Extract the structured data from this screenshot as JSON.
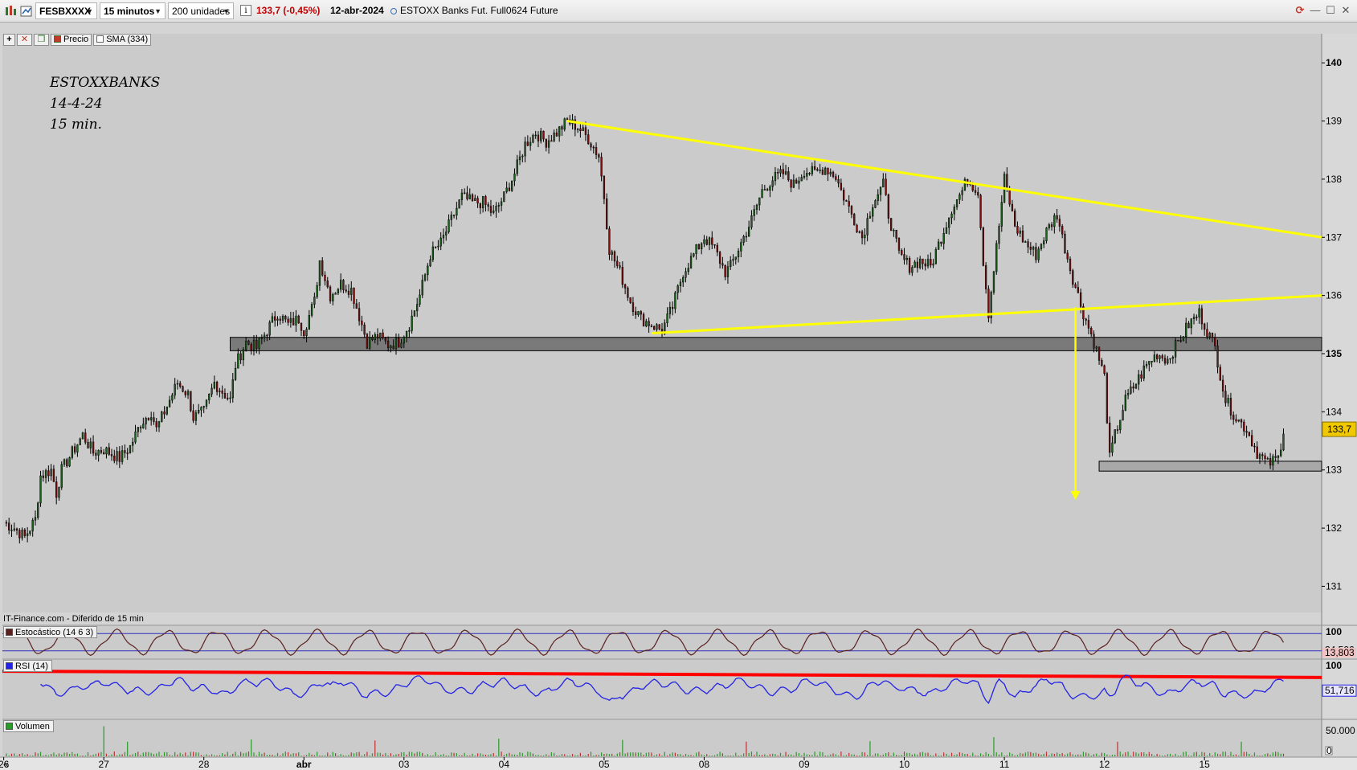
{
  "toolbar": {
    "symbol": "FESBXXXX",
    "interval": "15 minutos",
    "units": "200 unidades",
    "price_change": "133,7 (-0,45%)",
    "date": "12-abr-2024",
    "description": "ESTOXX Banks Fut. Full0624 Future",
    "icons": [
      "chart-icon",
      "compare-icon",
      "info-icon",
      "refresh-icon",
      "minimize-icon",
      "restore-icon",
      "close-icon"
    ],
    "info_glyph": "i",
    "win_glyphs": {
      "refresh": "⟳",
      "minimize": "—",
      "restore": "☐",
      "close": "✕"
    }
  },
  "legend": {
    "price_label": "Precio",
    "sma_label": "SMA (334)"
  },
  "annotation": {
    "line1": "ESTOXXBANKS",
    "line2": "14-4-24",
    "line3": "15 min."
  },
  "source_note": "IT-Finance.com - Diferido de 15 min",
  "panes": {
    "stochastic": {
      "label": "Estocástico (14 6 3)",
      "value1": "24,506",
      "value2": "13,803",
      "top_label": "100"
    },
    "rsi": {
      "label": "RSI (14)",
      "value": "51,716",
      "top_label": "100"
    },
    "volume": {
      "label": "Volumen",
      "top_label": "50.000",
      "bottom_label": "0"
    }
  },
  "colors": {
    "background": "#cbcbcb",
    "candle": "#000000",
    "trendline": "#ffff00",
    "rsi": "#2323e6",
    "rsi_trend": "#ff0000",
    "stochastic": "#5a2020",
    "price_tag": "#f0c800"
  },
  "chart_data": {
    "type": "candlestick",
    "current_price": 133.7,
    "current_price_label": "133,7",
    "ylim": [
      130.55,
      140.5
    ],
    "yticks": [
      131,
      132,
      133,
      134,
      135,
      136,
      137,
      138,
      139,
      140
    ],
    "x_date_labels": [
      {
        "label": "26",
        "idx": 0
      },
      {
        "label": "27",
        "idx": 38
      },
      {
        "label": "28",
        "idx": 76
      },
      {
        "label": "abr",
        "idx": 114
      },
      {
        "label": "03",
        "idx": 152
      },
      {
        "label": "04",
        "idx": 190
      },
      {
        "label": "05",
        "idx": 228
      },
      {
        "label": "08",
        "idx": 266
      },
      {
        "label": "09",
        "idx": 304
      },
      {
        "label": "10",
        "idx": 342
      },
      {
        "label": "11",
        "idx": 380
      },
      {
        "label": "12",
        "idx": 418
      },
      {
        "label": "15",
        "idx": 456
      }
    ],
    "x_total_bars": 501,
    "close_path": [
      [
        0,
        132.1
      ],
      [
        4,
        132.0
      ],
      [
        8,
        131.85
      ],
      [
        12,
        132.15
      ],
      [
        14,
        132.9
      ],
      [
        18,
        133.0
      ],
      [
        20,
        132.6
      ],
      [
        22,
        133.0
      ],
      [
        26,
        133.3
      ],
      [
        30,
        133.6
      ],
      [
        34,
        133.3
      ],
      [
        38,
        133.35
      ],
      [
        44,
        133.2
      ],
      [
        48,
        133.4
      ],
      [
        52,
        133.8
      ],
      [
        56,
        134.0
      ],
      [
        58,
        133.7
      ],
      [
        62,
        134.1
      ],
      [
        66,
        134.5
      ],
      [
        70,
        134.3
      ],
      [
        72,
        133.9
      ],
      [
        76,
        134.0
      ],
      [
        80,
        134.5
      ],
      [
        86,
        134.2
      ],
      [
        88,
        134.8
      ],
      [
        92,
        135.2
      ],
      [
        96,
        135.1
      ],
      [
        100,
        135.4
      ],
      [
        104,
        135.7
      ],
      [
        108,
        135.5
      ],
      [
        112,
        135.6
      ],
      [
        114,
        135.4
      ],
      [
        118,
        135.9
      ],
      [
        120,
        136.6
      ],
      [
        124,
        136.0
      ],
      [
        128,
        136.2
      ],
      [
        132,
        136.1
      ],
      [
        134,
        135.8
      ],
      [
        138,
        135.2
      ],
      [
        142,
        135.3
      ],
      [
        146,
        135.15
      ],
      [
        150,
        135.2
      ],
      [
        154,
        135.5
      ],
      [
        158,
        136.0
      ],
      [
        162,
        136.7
      ],
      [
        166,
        136.9
      ],
      [
        170,
        137.3
      ],
      [
        174,
        137.7
      ],
      [
        178,
        137.6
      ],
      [
        182,
        137.6
      ],
      [
        186,
        137.4
      ],
      [
        190,
        137.7
      ],
      [
        194,
        138.1
      ],
      [
        198,
        138.6
      ],
      [
        202,
        138.8
      ],
      [
        206,
        138.65
      ],
      [
        210,
        138.8
      ],
      [
        214,
        139.0
      ],
      [
        218,
        138.9
      ],
      [
        222,
        138.7
      ],
      [
        226,
        138.4
      ],
      [
        228,
        137.7
      ],
      [
        230,
        136.8
      ],
      [
        234,
        136.4
      ],
      [
        238,
        135.9
      ],
      [
        242,
        135.6
      ],
      [
        246,
        135.5
      ],
      [
        250,
        135.4
      ],
      [
        254,
        135.8
      ],
      [
        258,
        136.4
      ],
      [
        262,
        136.7
      ],
      [
        266,
        137.0
      ],
      [
        270,
        136.8
      ],
      [
        274,
        136.4
      ],
      [
        276,
        136.5
      ],
      [
        280,
        136.9
      ],
      [
        284,
        137.3
      ],
      [
        288,
        137.8
      ],
      [
        292,
        138.0
      ],
      [
        296,
        138.1
      ],
      [
        300,
        137.9
      ],
      [
        304,
        138.15
      ],
      [
        308,
        138.1
      ],
      [
        312,
        138.2
      ],
      [
        316,
        138.05
      ],
      [
        318,
        137.8
      ],
      [
        322,
        137.4
      ],
      [
        326,
        137.0
      ],
      [
        330,
        137.6
      ],
      [
        334,
        137.9
      ],
      [
        336,
        137.4
      ],
      [
        340,
        136.7
      ],
      [
        344,
        136.5
      ],
      [
        348,
        136.6
      ],
      [
        352,
        136.5
      ],
      [
        356,
        137.0
      ],
      [
        360,
        137.5
      ],
      [
        364,
        137.8
      ],
      [
        366,
        138.0
      ],
      [
        370,
        137.8
      ],
      [
        372,
        136.6
      ],
      [
        374,
        135.7
      ],
      [
        378,
        137.2
      ],
      [
        380,
        138.0
      ],
      [
        384,
        137.2
      ],
      [
        388,
        136.9
      ],
      [
        392,
        136.7
      ],
      [
        396,
        137.1
      ],
      [
        400,
        137.4
      ],
      [
        402,
        137.0
      ],
      [
        406,
        136.3
      ],
      [
        410,
        135.7
      ],
      [
        414,
        135.2
      ],
      [
        418,
        134.6
      ],
      [
        420,
        133.2
      ],
      [
        422,
        133.6
      ],
      [
        426,
        134.2
      ],
      [
        430,
        134.5
      ],
      [
        434,
        134.8
      ],
      [
        438,
        135.0
      ],
      [
        442,
        134.9
      ],
      [
        446,
        135.2
      ],
      [
        450,
        135.5
      ],
      [
        454,
        135.7
      ],
      [
        458,
        135.3
      ],
      [
        460,
        135.1
      ],
      [
        464,
        134.2
      ],
      [
        468,
        133.9
      ],
      [
        472,
        133.7
      ],
      [
        476,
        133.3
      ],
      [
        480,
        133.1
      ],
      [
        484,
        133.2
      ],
      [
        486,
        133.7
      ]
    ],
    "horizontal_zones": [
      {
        "name": "support-zone-135",
        "y1": 135.05,
        "y2": 135.28,
        "from_idx": 86
      },
      {
        "name": "support-zone-133",
        "y1": 132.98,
        "y2": 133.15,
        "from_idx": 416
      }
    ],
    "trendlines": [
      {
        "name": "upper-resistance-trendline",
        "from": [
          214,
          139.0
        ],
        "to": [
          501,
          137.0
        ]
      },
      {
        "name": "lower-support-trendline",
        "from": [
          246,
          135.35
        ],
        "to": [
          501,
          136.0
        ]
      }
    ],
    "target_arrow": {
      "x_idx": 407,
      "from": 135.8,
      "to": 132.5
    },
    "stochastic": {
      "ylim": [
        0,
        100
      ],
      "levels": [
        80,
        20
      ]
    },
    "rsi": {
      "ylim": [
        20,
        100
      ],
      "trend_from": 86,
      "trend_to": 77
    }
  }
}
